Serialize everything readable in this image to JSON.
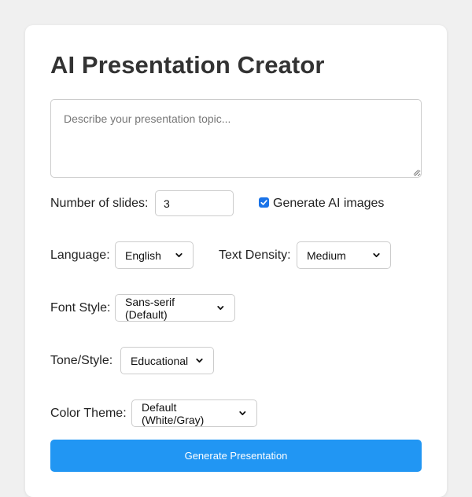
{
  "page": {
    "title": "AI Presentation Creator"
  },
  "topic": {
    "placeholder": "Describe your presentation topic...",
    "value": ""
  },
  "slides": {
    "label": "Number of slides:",
    "value": "3"
  },
  "images": {
    "label": "Generate AI images",
    "checked": true
  },
  "language": {
    "label": "Language:",
    "selected": "English"
  },
  "density": {
    "label": "Text Density:",
    "selected": "Medium"
  },
  "font": {
    "label": "Font Style:",
    "selected": "Sans-serif (Default)"
  },
  "tone": {
    "label": "Tone/Style:",
    "selected": "Educational"
  },
  "theme": {
    "label": "Color Theme:",
    "selected": "Default (White/Gray)"
  },
  "generate": {
    "label": "Generate Presentation"
  },
  "colors": {
    "page_bg": "#f0f0f0",
    "card_bg": "#ffffff",
    "accent": "#2196f3",
    "checkbox": "#1a73e8"
  }
}
